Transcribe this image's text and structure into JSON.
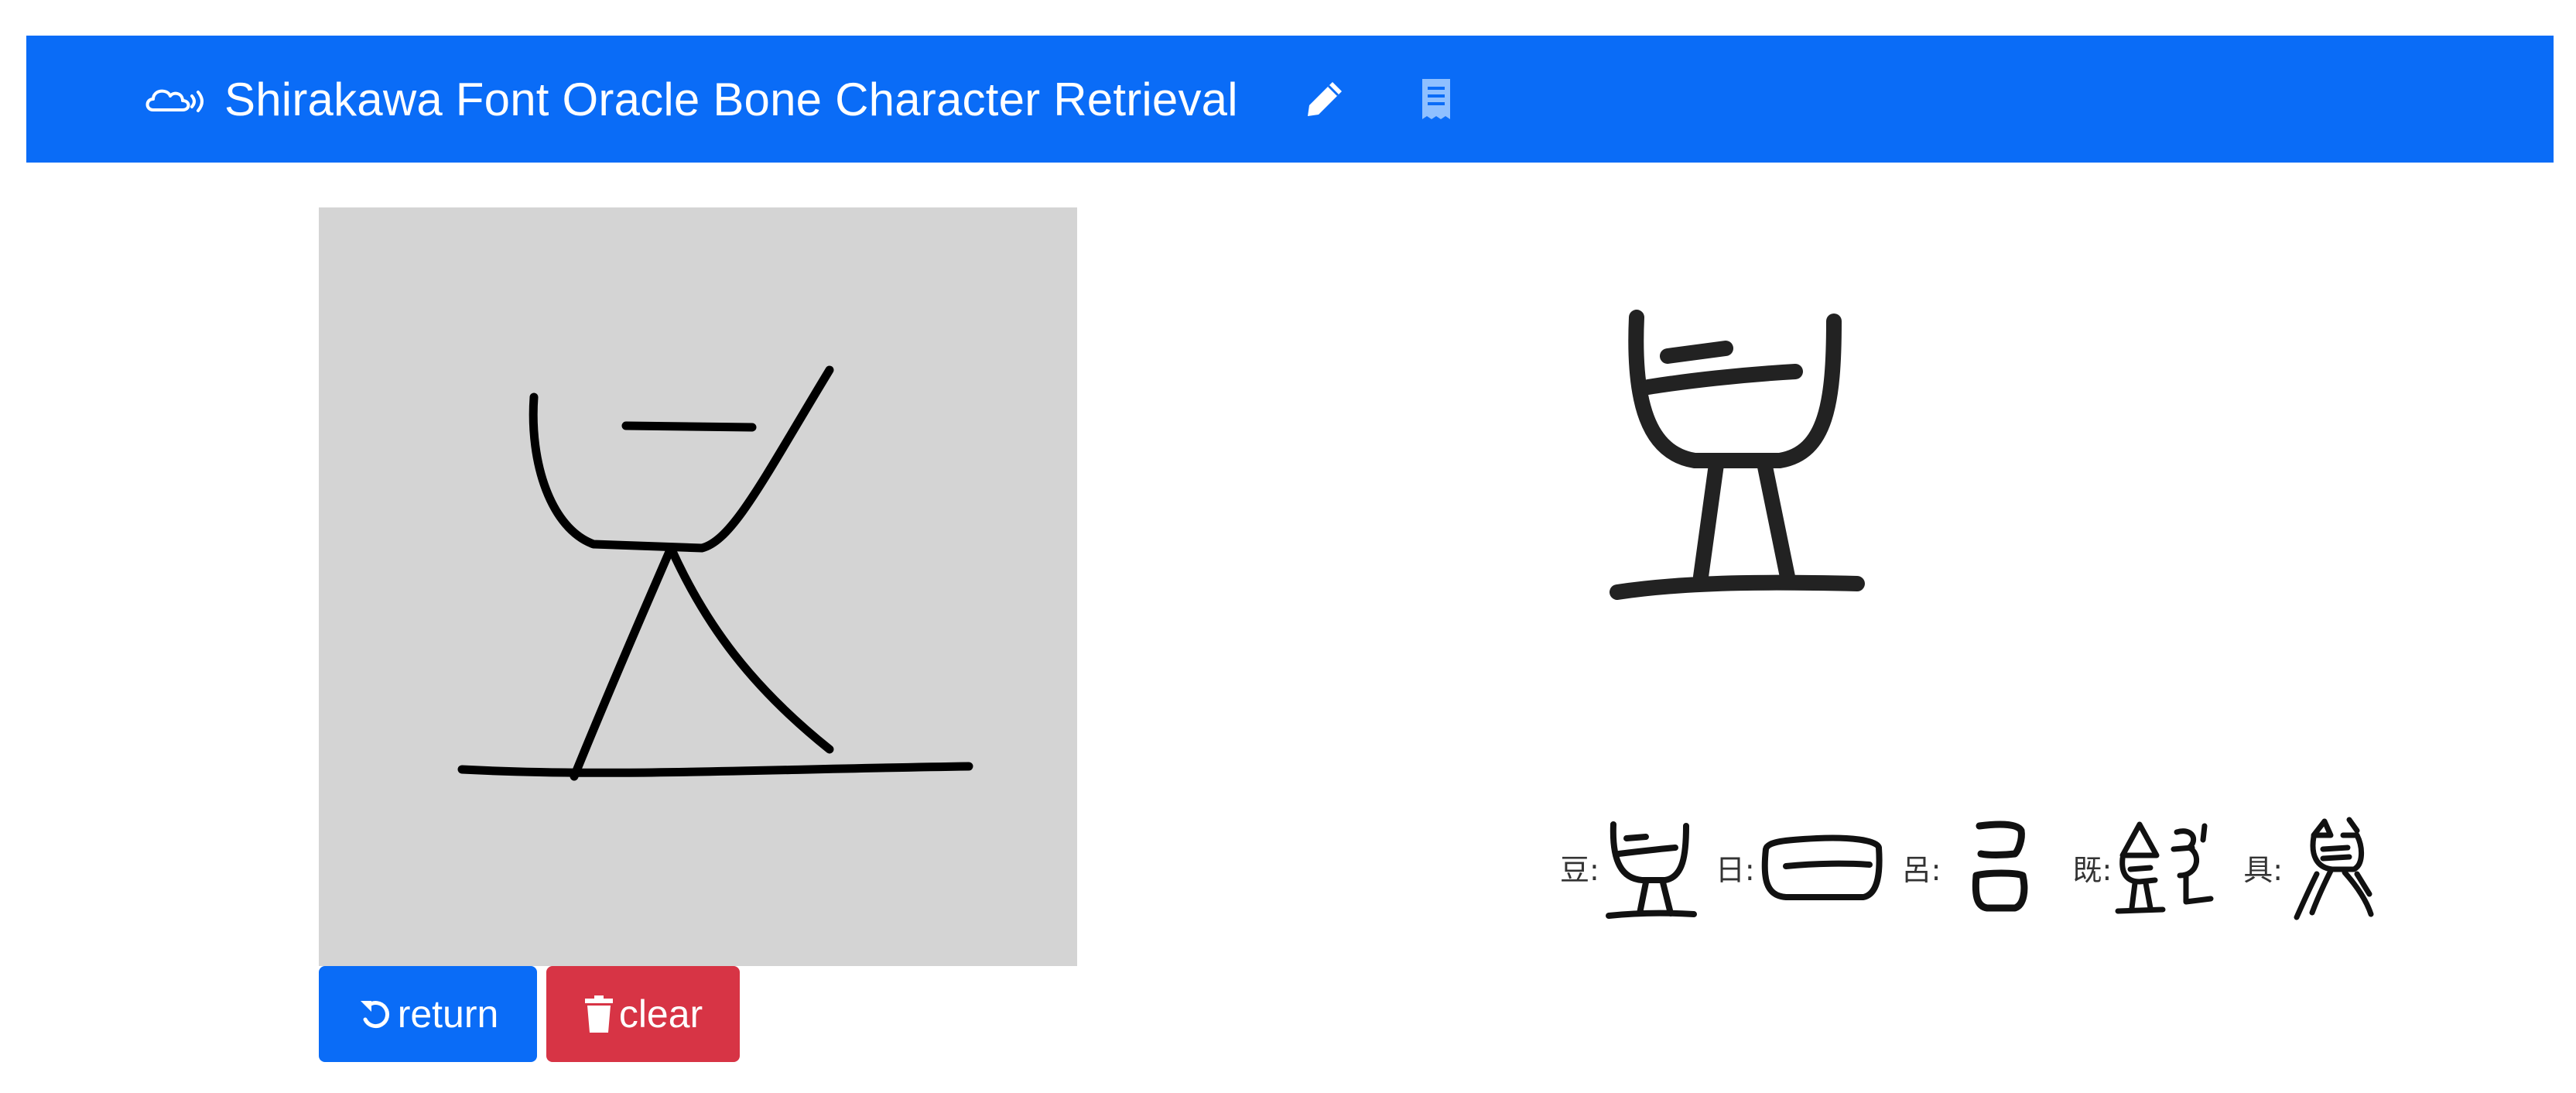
{
  "navbar": {
    "brand_icon": "cloud-signal-icon",
    "brand_text": "Shirakawa Font Oracle Bone Character Retrieval",
    "pencil_icon": "pencil-icon",
    "receipt_icon": "receipt-icon",
    "background_color": "#0a6cf7"
  },
  "canvas": {
    "background_color": "#d4d4d4",
    "stroke_color": "#000000"
  },
  "buttons": {
    "return_label": "return",
    "return_icon": "undo-icon",
    "return_color": "#0a6cf7",
    "clear_label": "clear",
    "clear_icon": "trash-icon",
    "clear_color": "#d73445"
  },
  "result": {
    "glyph_icon": "oracle-glyph-dou"
  },
  "candidates": [
    {
      "label": "豆:",
      "glyph_icon": "oracle-glyph-dou"
    },
    {
      "label": "日:",
      "glyph_icon": "oracle-glyph-ri"
    },
    {
      "label": "呂:",
      "glyph_icon": "oracle-glyph-lv"
    },
    {
      "label": "既:",
      "glyph_icon": "oracle-glyph-ji"
    },
    {
      "label": "具:",
      "glyph_icon": "oracle-glyph-ju"
    }
  ]
}
